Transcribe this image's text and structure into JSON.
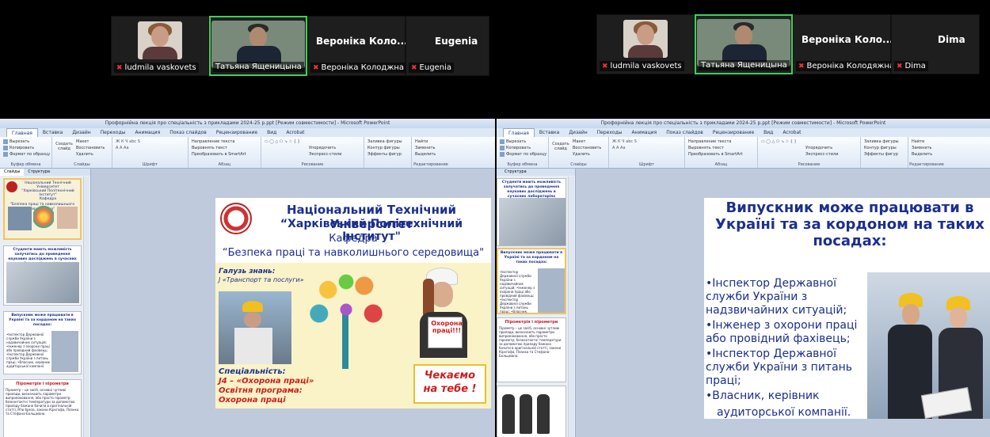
{
  "participants_left": [
    {
      "label": "ludmila vaskovets",
      "type": "photo-woman"
    },
    {
      "label": "Татьяна Ященицына",
      "type": "photo-man",
      "active": true
    },
    {
      "label": "Вероніка Колоджна",
      "display": "Вероніка Коло...",
      "type": "name"
    },
    {
      "label": "Eugenia",
      "display": "Eugenia",
      "type": "name"
    }
  ],
  "participants_right": [
    {
      "label": "ludmila vaskovets",
      "type": "photo-woman"
    },
    {
      "label": "Татьяна Ященицына",
      "type": "photo-man",
      "active": true
    },
    {
      "label": "Вероніка Колодяжна",
      "display": "Вероніка Коло...",
      "type": "name"
    },
    {
      "label": "Dima",
      "display": "Dima",
      "type": "name"
    }
  ],
  "ppt": {
    "title": "Профорнійна лекція про  спеціальність з прикладами 2024-25 р.ppt [Режим совместимости] - Microsoft PowerPoint",
    "tabs": [
      "Главная",
      "Вставка",
      "Дизайн",
      "Переходы",
      "Анимация",
      "Показ слайдов",
      "Рецензирование",
      "Вид",
      "Acrobat"
    ],
    "ribbon": {
      "clipboard": [
        "Вырезать",
        "Копировать",
        "Формат по образцу"
      ],
      "clipboard_name": "Буфер обмена",
      "create_slide": "Создать слайд",
      "slides": [
        "Макет",
        "Восстановить",
        "Удалить"
      ],
      "slides_name": "Слайды",
      "font_name": "Шрифт",
      "para": [
        "Направление текста",
        "Выровнять текст",
        "Преобразовать в SmartArt"
      ],
      "para_name": "Абзац",
      "drawing_name": "Рисование",
      "arrange": "Упорядочить",
      "express": "Экспресс-стили",
      "fmt": [
        "Заливка фигуры",
        "Контур фигуры",
        "Эффекты фигур"
      ],
      "edit": [
        "Найти",
        "Заменить",
        "Выделить"
      ],
      "edit_name": "Редактирование"
    },
    "panel_tabs": [
      "Слайды",
      "Структура"
    ]
  },
  "slide_left": {
    "uni1": "Національний  Технічний  Університет",
    "uni2": "“Харківський Політехнічний Інститут\"",
    "dept": "Кафедра",
    "dept_name": "“Безпека праці та навколишнього середовища\"",
    "field_label": "Галузь знань:",
    "field": "J «Транспорт та послуги»",
    "spec_label": "Спеціальність:",
    "spec": "J4 – «Охорона праці»",
    "program_label": "Освітня програма:",
    "program": "Охорона праці",
    "sign": "Охорона праці!!!",
    "wait": "Чекаємо на тебе !"
  },
  "slide_right": {
    "title": "Випускник може працювати в Україні та за кордоном на таких посадах:",
    "items": [
      "•Інспектор Державної служби України з надзвичайних ситуацій;",
      "•Інженер з охорони праці або провідний фахівець;",
      "•Інспектор Державної служби України з питань праці;",
      "•Власник, керівник",
      "аудиторської компанії."
    ]
  },
  "thumbs_left": {
    "t1a": "Національний Технічний Університет",
    "t1b": "\"Харківський Політехнічний Інститут\"",
    "t1c": "Кафедра",
    "t1d": "\"Безпека праці та навколишнього середовища\"",
    "t2": "Студенти мають можливість залучатись до проведення наукових досліджень в сучасних лабораторіях кафедри",
    "t3": "Випускник може працювати в Україні та за кордоном на таких посадах:",
    "t3items": "•Інспектор Державної служби України з надзвичайних ситуацій; •Інженер з охорони праці або провідний фахівець; •Інспектор Державної служби України з питань праці; •Власник, керівник аудиторської компанії.",
    "t4": "Пірометрія і пірометри",
    "t4body": "Пірометр – це засіб, основні чутливі прилади, визначають параметри випромінювання, або просто пірометр; безконтактні температури за допомогою приладу бажано бачити в оригінальній статті, М'ю бреза, закони Кірхгофа, Планка та Стефана-Больцмана."
  },
  "thumbs_right": {
    "t1": "Студенти мають можливість залучатись до проведення наукових досліджень в сучасних лабораторіях кафедри",
    "t2": "Випускник може працювати в Україні та за кордоном на таких посадах:",
    "t2items": "•Інспектор Державної служби України з надзвичайних ситуацій; •Інженер з охорони праці або провідний фахівець; •Інспектор Державної служби України з питань праці; •Власник, керівник аудиторської компанії.",
    "t3": "Пірометрія і пірометри",
    "t3body": "Пірометр – це засіб, основні чутливі прилади, визначають параметри випромінювання, або просто пірометр; безконтактні температури за допомогою приладу бажано бачити в оригінальній статті, закони Кірхгофа, Планка та Стефана-Больцмана."
  }
}
